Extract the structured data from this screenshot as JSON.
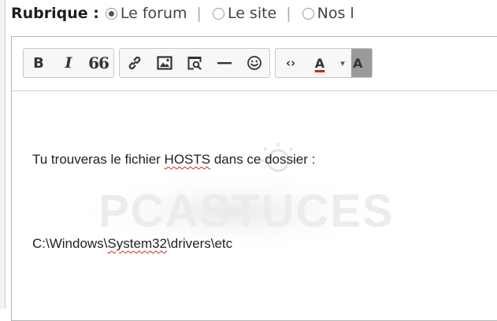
{
  "rubrique": {
    "label": "Rubrique :",
    "options": [
      {
        "label": "Le forum",
        "checked": true
      },
      {
        "label": "Le site",
        "checked": false
      },
      {
        "label": "Nos l",
        "checked": false
      }
    ],
    "separator": "|"
  },
  "toolbar": {
    "bold": "B",
    "italic": "I",
    "quote": "66",
    "color_letter": "A",
    "color_dropdown": "▾",
    "bg_letter": "A",
    "code": "‹›",
    "colors": {
      "text_color_underline": "#d02020",
      "bg_color_swatch": "#9a9a9a"
    }
  },
  "content": {
    "line1_before": "Tu trouveras le fichier ",
    "line1_word": "HOSTS",
    "line1_after": " dans ce dossier :",
    "line2_before": "C:\\Windows\\",
    "line2_word": "System32",
    "line2_after": "\\drivers\\etc",
    "watermark": "PCASTUCES"
  }
}
